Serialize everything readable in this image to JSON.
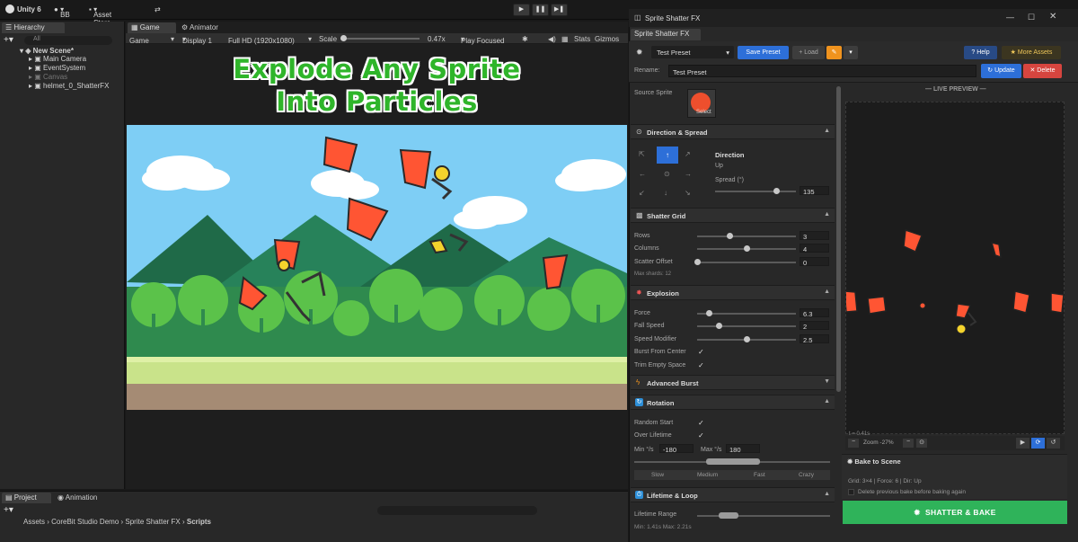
{
  "topbar": {
    "app": "Unity 6",
    "account": "BB",
    "asset_store": "Asset Store"
  },
  "hierarchy": {
    "tab": "Hierarchy",
    "search_placeholder": "All",
    "items": [
      {
        "label": "New Scene*"
      },
      {
        "label": "Main Camera"
      },
      {
        "label": "EventSystem"
      },
      {
        "label": "Canvas"
      },
      {
        "label": "helmet_0_ShatterFX"
      }
    ]
  },
  "game_view": {
    "tabs": [
      "Game",
      "Animator"
    ],
    "display_mode": "Game",
    "display": "Display 1",
    "resolution": "Full HD (1920x1080)",
    "scale_label": "Scale",
    "scale_value": "0.47x",
    "play_mode": "Play Focused",
    "stats": "Stats",
    "gizmos": "Gizmos",
    "title_line1": "Explode Any Sprite",
    "title_line2": "Into Particles"
  },
  "bottom": {
    "tabs": [
      "Project",
      "Animation"
    ],
    "breadcrumb": [
      "Assets",
      "CoreBit Studio Demo",
      "Sprite Shatter FX",
      "Scripts"
    ]
  },
  "fx_window": {
    "window_title": "Sprite Shatter FX",
    "tab": "Sprite Shatter FX",
    "preset": "Test Preset",
    "save_preset": "Save Preset",
    "load": "+ Load",
    "help": "? Help",
    "more_assets": "More Assets",
    "rename_label": "Rename:",
    "rename_value": "Test Preset",
    "update": "Update",
    "delete": "Delete",
    "source_sprite_label": "Source Sprite",
    "select": "Select",
    "sections": {
      "direction": "Direction & Spread",
      "shatter_grid": "Shatter Grid",
      "explosion": "Explosion",
      "advanced": "Advanced Burst",
      "rotation": "Rotation",
      "lifetime": "Lifetime & Loop"
    },
    "direction_label": "Direction",
    "direction_value": "Up",
    "spread_label": "Spread (°)",
    "spread_value": "135",
    "spread_fraction": 0.75,
    "grid": {
      "rows_label": "Rows",
      "rows": "3",
      "rows_fraction": 0.33,
      "cols_label": "Columns",
      "cols": "4",
      "cols_fraction": 0.5,
      "scatter_label": "Scatter Offset",
      "scatter": "0",
      "scatter_fraction": 0.0,
      "max_shards": "Max shards: 12"
    },
    "explosion": {
      "force_label": "Force",
      "force": "6.3",
      "force_fraction": 0.12,
      "fall_label": "Fall Speed",
      "fall": "2",
      "fall_fraction": 0.22,
      "speedmod_label": "Speed Modifier",
      "speedmod": "2.5",
      "speedmod_fraction": 0.5,
      "burst_label": "Burst From Center",
      "trim_label": "Trim Empty Space"
    },
    "rotation": {
      "random_start": "Random Start",
      "over_lifetime": "Over Lifetime",
      "min_label": "Min °/s",
      "min": "-180",
      "max_label": "Max °/s",
      "max": "180",
      "speeds": [
        "Slow",
        "Medium",
        "Fast",
        "Crazy"
      ]
    },
    "lifetime": {
      "range_label": "Lifetime Range",
      "range_text": "Min: 1.41s   Max: 2.21s"
    },
    "preview": {
      "header": "— LIVE PREVIEW —",
      "time": "t = 0.41s",
      "zoom": "Zoom -27%"
    },
    "bake": {
      "title": "Bake to Scene",
      "info": "Grid: 3×4  |  Force: 6  |  Dir: Up",
      "delete_prev": "Delete previous bake before baking again",
      "shatter_button": "SHATTER & BAKE"
    }
  }
}
